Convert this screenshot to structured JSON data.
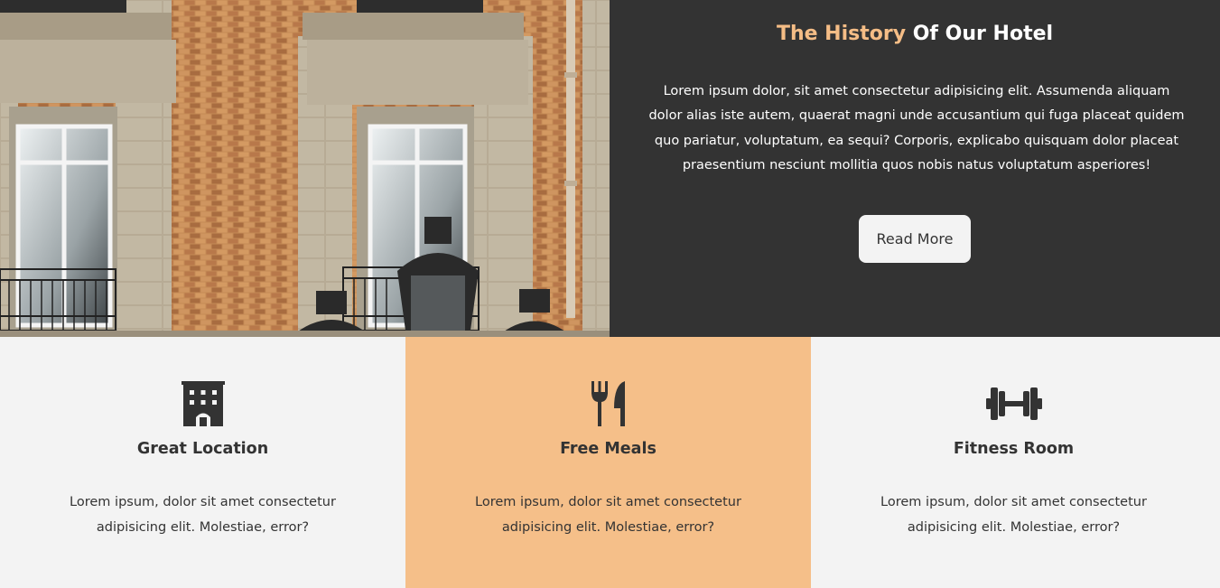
{
  "history": {
    "title_accent": "The History",
    "title_rest": "Of Our Hotel",
    "body": "Lorem ipsum dolor, sit amet consectetur adipisicing elit. Assumenda aliquam dolor alias iste autem, quaerat magni unde accusantium qui fuga placeat quidem quo pariatur, voluptatum, ea sequi? Corporis, explicabo quisquam dolor placeat praesentium nesciunt mollitia quos nobis natus voluptatum asperiores!",
    "button_label": "Read More"
  },
  "colors": {
    "accent": "#f5bd86",
    "dark_panel": "#333333",
    "highlight_card": "#f5bf89",
    "light_bg": "#f3f3f3"
  },
  "features": [
    {
      "icon": "hotel-icon",
      "title": "Great Location",
      "text": "Lorem ipsum, dolor sit amet consectetur adipisicing elit. Molestiae, error?"
    },
    {
      "icon": "utensils-icon",
      "title": "Free Meals",
      "text": "Lorem ipsum, dolor sit amet consectetur adipisicing elit. Molestiae, error?"
    },
    {
      "icon": "dumbbell-icon",
      "title": "Fitness Room",
      "text": "Lorem ipsum, dolor sit amet consectetur adipisicing elit. Molestiae, error?"
    }
  ]
}
